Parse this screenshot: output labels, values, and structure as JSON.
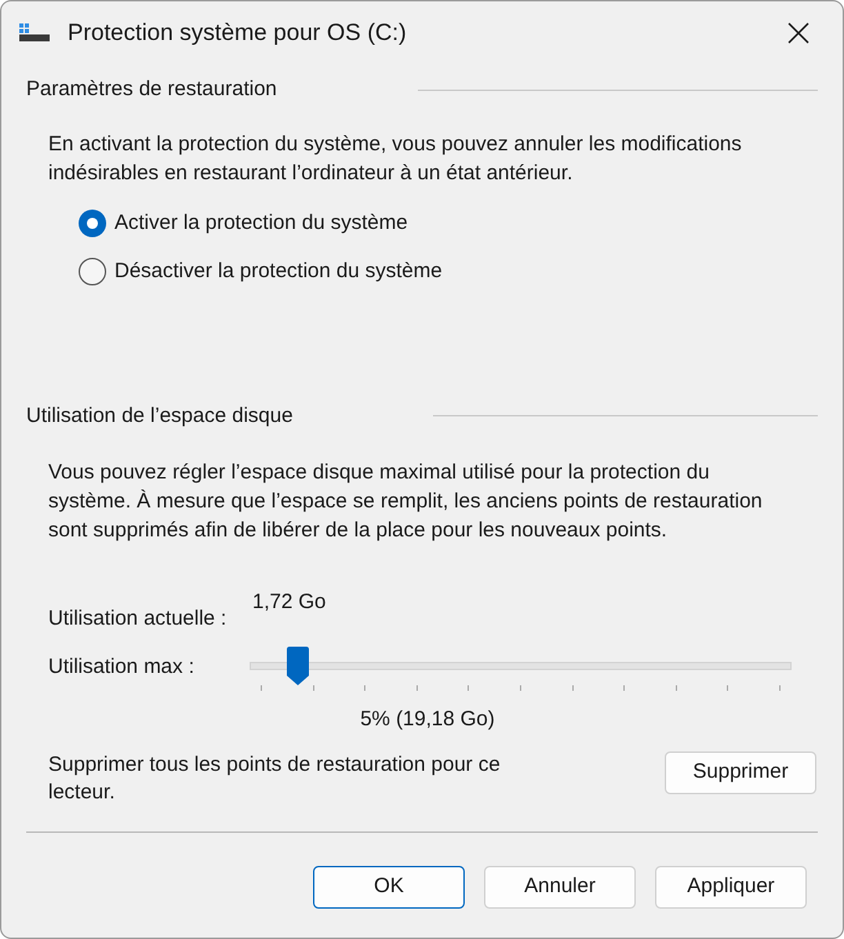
{
  "window": {
    "title": "Protection système pour OS (C:)"
  },
  "restore_settings": {
    "heading": "Paramètres de restauration",
    "description": "En activant la protection du système, vous pouvez annuler les modifications indésirables en restaurant l’ordinateur à un état antérieur.",
    "options": [
      {
        "label": "Activer la protection du système",
        "selected": true
      },
      {
        "label": "Désactiver la protection du système",
        "selected": false
      }
    ]
  },
  "disk_usage": {
    "heading": "Utilisation de l’espace disque",
    "description": "Vous pouvez régler l’espace disque maximal utilisé pour la protection du système. À mesure que l’espace se remplit, les anciens points de restauration sont supprimés afin de libérer de la place pour les nouveaux points.",
    "current_label": "Utilisation actuelle :",
    "current_value": "1,72 Go",
    "max_label": "Utilisation max :",
    "max_slider": {
      "level": 0.05
    },
    "max_reading": "5% (19,18 Go)",
    "delete_text": "Supprimer tous les points de restauration pour ce lecteur.",
    "delete_button": "Supprimer"
  },
  "buttons": [
    {
      "label": "OK",
      "default": true
    },
    {
      "label": "Annuler",
      "default": false
    },
    {
      "label": "Appliquer",
      "default": false
    }
  ]
}
